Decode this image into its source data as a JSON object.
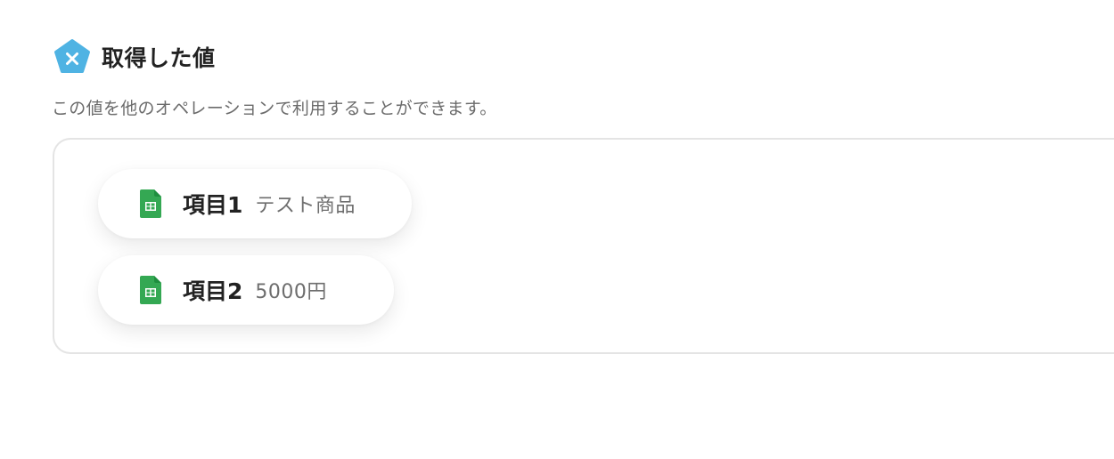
{
  "section": {
    "title": "取得した値",
    "icon": "variable-x-pentagon-icon",
    "description": "この値を他のオペレーションで利用することができます。"
  },
  "values": [
    {
      "label": "項目1",
      "value": "テスト商品",
      "icon": "google-sheets-icon"
    },
    {
      "label": "項目2",
      "value": "5000円",
      "icon": "google-sheets-icon"
    }
  ],
  "colors": {
    "accent": "#4fb3e3",
    "sheets_green": "#34a853",
    "panel_border": "#e4e4e4",
    "description_text": "#6b6b6b"
  }
}
